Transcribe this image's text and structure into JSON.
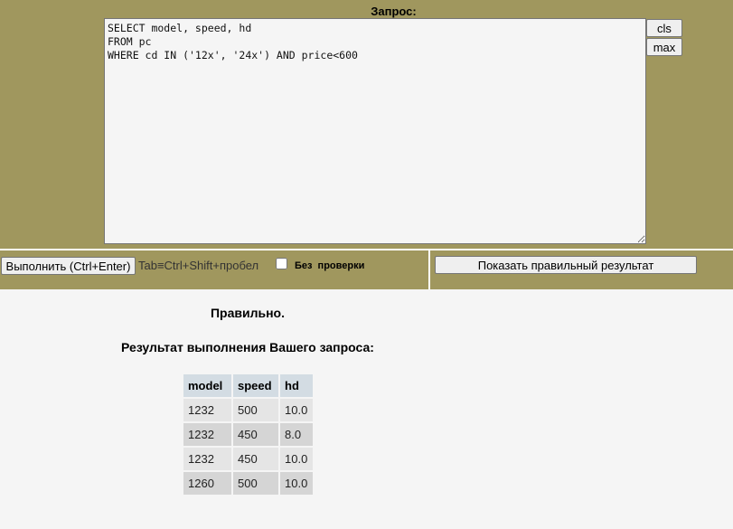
{
  "query_panel": {
    "title": "Запрос:",
    "sql": "SELECT model, speed, hd\nFROM pc\nWHERE cd IN ('12x', '24x') AND price<600",
    "cls_label": "cls",
    "max_label": "max"
  },
  "toolbar": {
    "run_label": "Выполнить (Ctrl+Enter)",
    "hint": "Tab≡Ctrl+Shift+пробел",
    "no_check_label": "Без проверки",
    "no_check_checked": false,
    "show_correct_label": "Показать правильный результат"
  },
  "result": {
    "status": "Правильно.",
    "title": "Результат выполнения Вашего запроса:",
    "columns": [
      "model",
      "speed",
      "hd"
    ],
    "rows": [
      [
        "1232",
        "500",
        "10.0"
      ],
      [
        "1232",
        "450",
        "8.0"
      ],
      [
        "1232",
        "450",
        "10.0"
      ],
      [
        "1260",
        "500",
        "10.0"
      ]
    ]
  },
  "colors": {
    "panel": "#a0975e",
    "page_background": "#f5f5f5",
    "header_cell": "#d3dce3",
    "row_odd": "#e5e5e5",
    "row_even": "#d5d5d5"
  }
}
